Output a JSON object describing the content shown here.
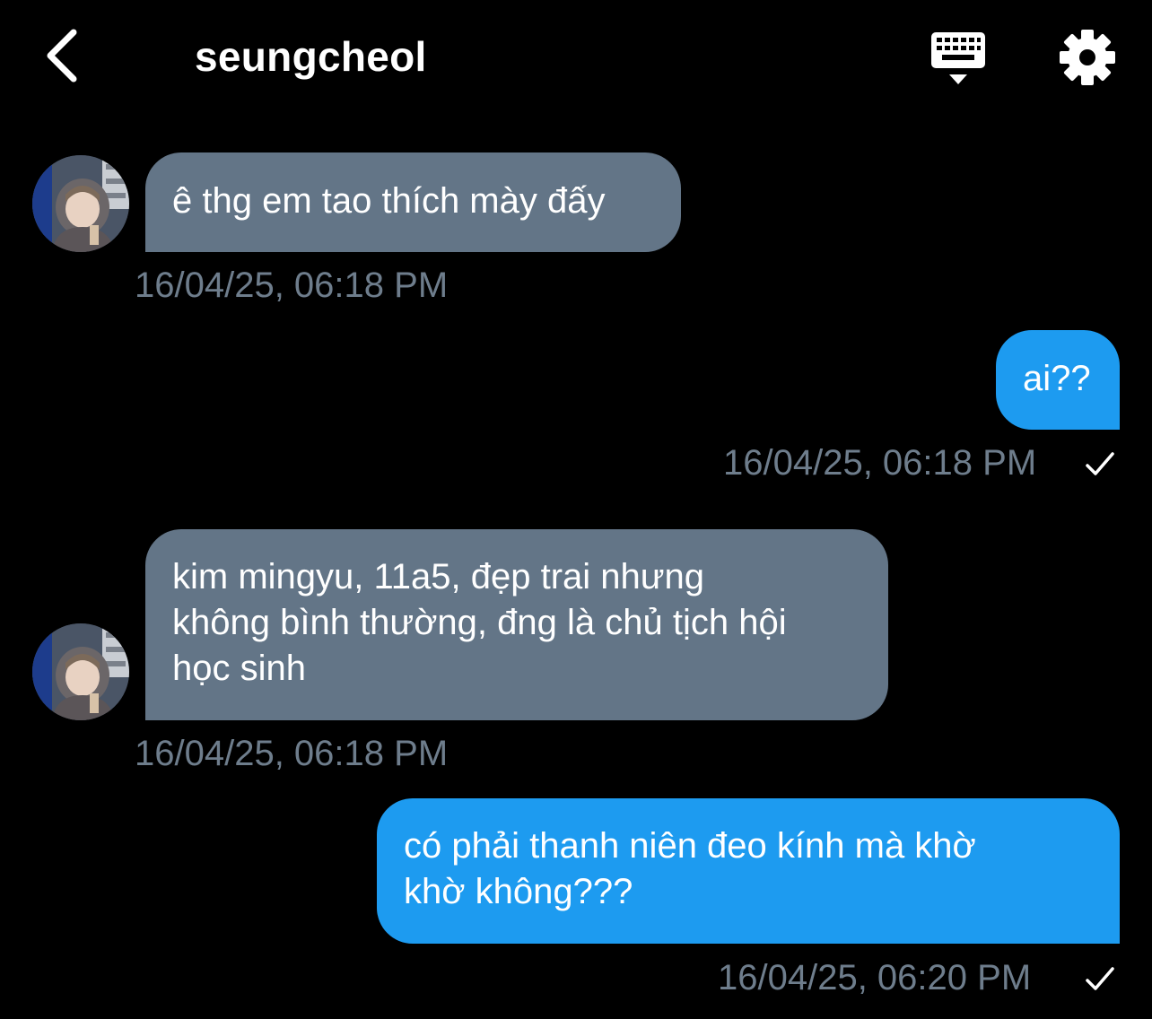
{
  "header": {
    "title": "seungcheol",
    "back_icon": "chevron-left-icon",
    "keyboard_icon": "keyboard-icon",
    "settings_icon": "gear-icon"
  },
  "colors": {
    "background": "#000000",
    "incoming_bubble": "#637587",
    "outgoing_bubble": "#1d9bf0",
    "timestamp": "#6e7d8c"
  },
  "messages": [
    {
      "direction": "incoming",
      "text": "ê thg em tao thích mày đấy",
      "timestamp": "16/04/25, 06:18 PM"
    },
    {
      "direction": "outgoing",
      "text": "ai??",
      "timestamp": "16/04/25, 06:18 PM",
      "status_icon": "checkmark-icon"
    },
    {
      "direction": "incoming",
      "lines": [
        "kim mingyu, 11a5, đẹp trai nhưng",
        "không bình thường, đng là chủ tịch hội",
        "học sinh"
      ],
      "timestamp": "16/04/25, 06:18 PM"
    },
    {
      "direction": "outgoing",
      "lines": [
        "có phải thanh niên đeo kính mà khờ",
        "khờ không???"
      ],
      "timestamp": "16/04/25, 06:20 PM",
      "status_icon": "checkmark-icon"
    }
  ]
}
